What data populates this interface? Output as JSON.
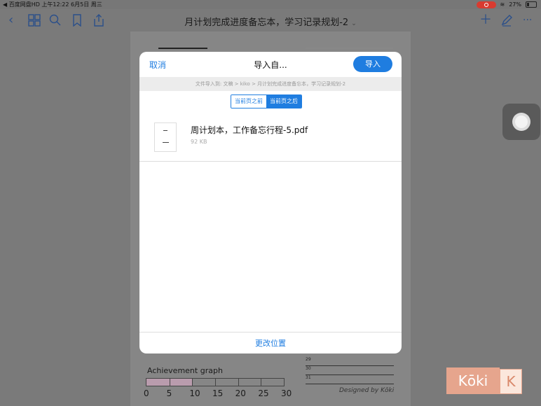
{
  "status_bar": {
    "left": "◀ 百度网盘HD  上午12:22  6月5日 周三",
    "battery": "27%"
  },
  "nav": {
    "title": "月计划完成进度备忘本，学习记录规划-2",
    "icons": [
      "back-chevron-icon",
      "grid-icon",
      "search-icon",
      "bookmark-icon",
      "share-icon",
      "plus-icon",
      "pen-icon",
      "more-icon"
    ]
  },
  "background_page": {
    "achievement_label": "Achievement graph",
    "achievement_value": 10,
    "achievement_max": 30,
    "ticks": [
      "0",
      "5",
      "10",
      "15",
      "20",
      "25",
      "30"
    ],
    "days": [
      "29",
      "30",
      "31"
    ],
    "designed_by": "Designed by Kōki"
  },
  "modal": {
    "cancel": "取消",
    "title": "导入自...",
    "import": "导入",
    "path": "文件导入到:  文稿 > kiko > 月计划完成进度备忘本，学习记录规划-2",
    "segments": [
      "当前页之前",
      "当前页之后"
    ],
    "selected_segment": 1,
    "file_name": "周计划本，工作备忘行程-5.pdf",
    "file_size": "92 KB",
    "change_location": "更改位置"
  },
  "watermark": {
    "left": "Kōki",
    "right": "K"
  },
  "colors": {
    "accent": "#1f7de0",
    "record": "#d93b30"
  }
}
